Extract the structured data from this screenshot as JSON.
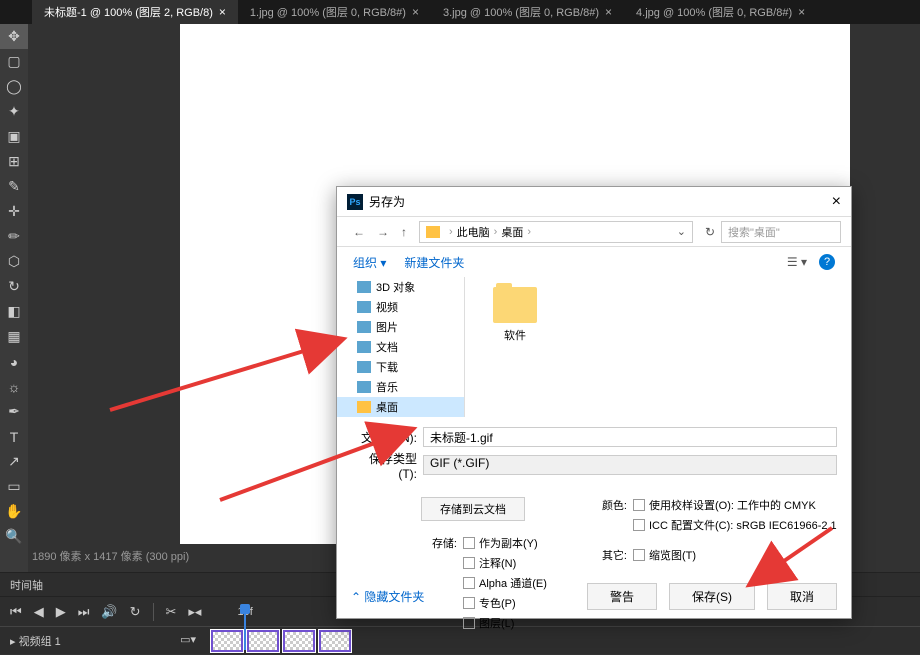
{
  "tabs": [
    {
      "label": "未标题-1 @ 100% (图层 2, RGB/8)"
    },
    {
      "label": "1.jpg @ 100% (图层 0, RGB/8#)"
    },
    {
      "label": "3.jpg @ 100% (图层 0, RGB/8#)"
    },
    {
      "label": "4.jpg @ 100% (图层 0, RGB/8#)"
    }
  ],
  "status": "1890 像素 x 1417 像素 (300 ppi)",
  "dialog": {
    "title": "另存为",
    "breadcrumb": {
      "part1": "此电脑",
      "part2": "桌面"
    },
    "search_placeholder": "搜索\"桌面\"",
    "organize": "组织",
    "new_folder": "新建文件夹",
    "sidebar": [
      {
        "label": "3D 对象"
      },
      {
        "label": "视频"
      },
      {
        "label": "图片"
      },
      {
        "label": "文档"
      },
      {
        "label": "下载"
      },
      {
        "label": "音乐"
      },
      {
        "label": "桌面"
      }
    ],
    "file_items": [
      {
        "label": "软件"
      }
    ],
    "filename_label": "文件名(N):",
    "filename_value": "未标题-1.gif",
    "savetype_label": "保存类型(T):",
    "savetype_value": "GIF (*.GIF)",
    "cloud_button": "存储到云文档",
    "store_label": "存储:",
    "checkboxes": [
      "作为副本(Y)",
      "注释(N)",
      "Alpha 通道(E)",
      "专色(P)",
      "图层(L)"
    ],
    "color_label": "颜色:",
    "color_opts": [
      "使用校样设置(O): 工作中的 CMYK",
      "ICC 配置文件(C): sRGB IEC61966-2.1"
    ],
    "other_label": "其它:",
    "other_opts": [
      "缩览图(T)"
    ],
    "hide_folders": "隐藏文件夹",
    "warning": "警告",
    "save": "保存(S)",
    "cancel": "取消"
  },
  "timeline": {
    "header": "时间轴",
    "fps": "10f",
    "track_label": "视频组 1"
  }
}
